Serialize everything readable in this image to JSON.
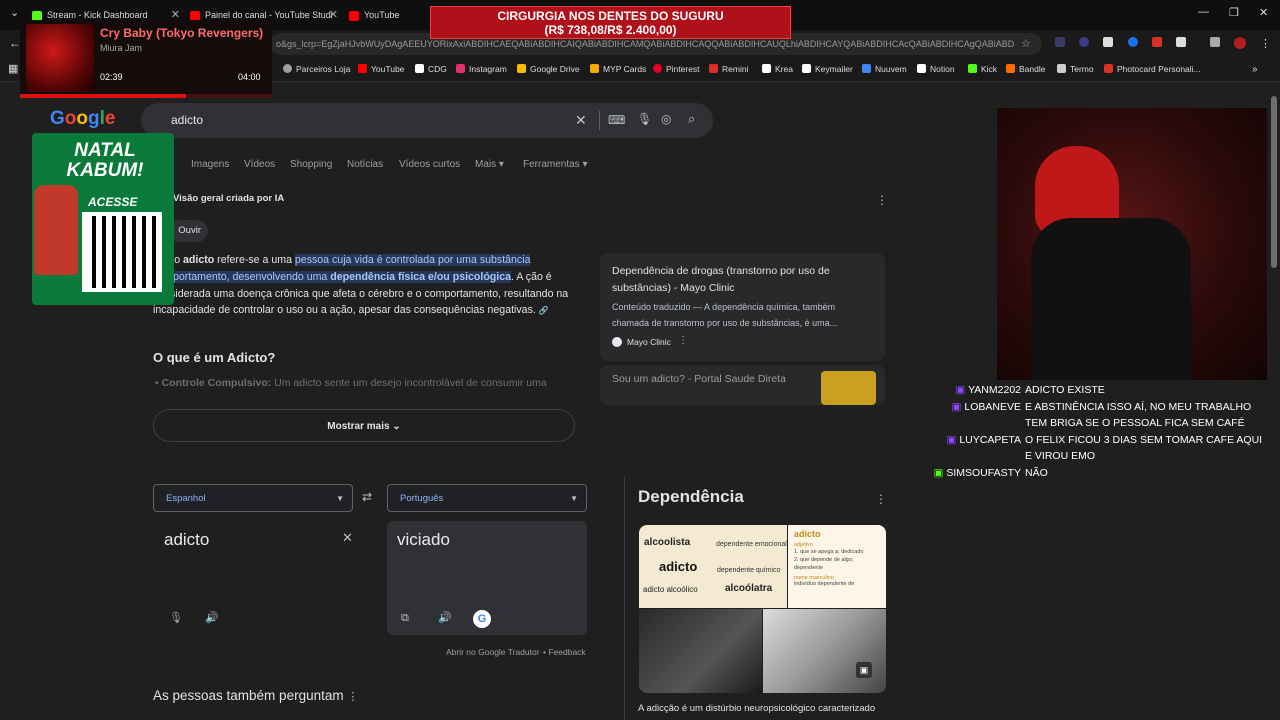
{
  "browser": {
    "tabs": [
      {
        "label": "Stream - Kick Dashboard",
        "color": "#53fc18"
      },
      {
        "label": "Painel do canal - YouTube Studi",
        "color": "#ff0000"
      },
      {
        "label": "YouTube",
        "color": "#ff0000"
      }
    ],
    "url": "o&gs_lcrp=EgZjaHJvbWUyDAgAEEUYORixAxiABDIHCAEQABiABDIHCAIQABiABDIHCAMQABiABDIHCAQQABiABDIHCAUQLhiABDIHCAYQABiABDIHCAcQABiABDIHCAgQABiABD",
    "bookmarks": [
      {
        "label": "Parceiros Loja",
        "color": "#9aa0a6"
      },
      {
        "label": "YouTube",
        "color": "#ff0000"
      },
      {
        "label": "CDG",
        "color": "#ffffff"
      },
      {
        "label": "Instagram",
        "color": "#e1306c"
      },
      {
        "label": "Google Drive",
        "color": "#fbbc04"
      },
      {
        "label": "MYP Cards",
        "color": "#f9ab00"
      },
      {
        "label": "Pinterest",
        "color": "#e60023"
      },
      {
        "label": "Remini",
        "color": "#d93025"
      },
      {
        "label": "Krea",
        "color": "#ffffff"
      },
      {
        "label": "Keymailer",
        "color": "#ffffff"
      },
      {
        "label": "Nuuvem",
        "color": "#4285f4"
      },
      {
        "label": "Notion",
        "color": "#ffffff"
      },
      {
        "label": "Kick",
        "color": "#53fc18"
      },
      {
        "label": "Bandle",
        "color": "#ff6d00"
      },
      {
        "label": "Termo",
        "color": "#cccccc"
      },
      {
        "label": "Photocard Personali...",
        "color": "#d93025"
      }
    ]
  },
  "overlay": {
    "song_title": "Cry Baby (Tokyo Revengers)",
    "song_artist": "Miura Jam",
    "time_current": "02:39",
    "time_total": "04:00",
    "progress": 0.66,
    "alert_line1": "CIRGURGIA NOS DENTES DO SUGURU",
    "alert_line2": "(R$ 738,08/R$ 2.400,00)",
    "promo_title": "NATAL KABUM!",
    "promo_cta": "ACESSE"
  },
  "google": {
    "logo": "Google",
    "query": "adicto",
    "nav_tabs": [
      "Imagens",
      "Vídeos",
      "Shopping",
      "Notícias",
      "Vídeos curtos",
      "Mais",
      "Ferramentas"
    ],
    "ai_label": "Visão geral criada por IA",
    "listen": "Ouvir",
    "ai_text": {
      "p1": "termo ",
      "p1b": "adicto",
      "p2": " refere-se a uma ",
      "hl1": "pessoa cuja vida é controlada por uma substância",
      "hl2": "comportamento, desenvolvendo uma ",
      "hl2b": "dependência física e/ou psicológica",
      "p3": ". A",
      "p4": "ção é considerada uma doença crônica que afeta o cérebro e o comportamento, resultando na incapacidade de controlar o uso ou a ação, apesar das consequências negativas."
    },
    "ai_heading": "O que é um Adicto?",
    "ai_bullet_b": "Controle Compulsivo:",
    "ai_bullet": " Um adicto sente um desejo incontrolável de consumir uma",
    "show_more": "Mostrar mais",
    "source1_title": "Dependência de drogas (transtorno por uso de substâncias) - Mayo Clinic",
    "source1_desc": "Conteúdo traduzido — A dependência química, também chamada de transtorno por uso de substâncias, é uma...",
    "source1_site": "Mayo Clinic",
    "source2_title": "Sou um adicto? - Portal Saude Direta",
    "translate": {
      "from": "Espanhol",
      "to": "Português",
      "source_word": "adicto",
      "target_word": "viciado",
      "open_link": "Abrir no Google Tradutor",
      "feedback": "Feedback"
    },
    "people_also_ask": "As pessoas também perguntam",
    "knowledge": {
      "title": "Dependência",
      "word_cloud": [
        "alcoolista",
        "dependente emocional",
        "adicto",
        "dependente químico",
        "adicto alcoólico",
        "alcoólatra"
      ],
      "dict_word": "adicto",
      "dict_pos": "adjetivo",
      "dict_def1": "1. que se apega a; dedicado",
      "dict_def2": "2. que depende de algo; dependente",
      "dict_noun": "nome masculino",
      "dict_noun_def": "indivíduo dependente de",
      "caption": "A adicção é um distúrbio neuropsicológico caracterizado"
    }
  },
  "chat": [
    {
      "user": "YANM2202",
      "color": "#ffffff",
      "msg": "ADICTO EXISTE"
    },
    {
      "user": "LOBANEVE",
      "color": "#ffffff",
      "msg": "E ABSTINÊNCIA ISSO AÍ, NO MEU TRABALHO TEM BRIGA SE O PESSOAL FICA SEM CAFÉ"
    },
    {
      "user": "LUYCAPETA",
      "color": "#ffffff",
      "msg": "O FELIX FICOU 3 DIAS SEM TOMAR CAFE AQUI E VIROU EMO"
    },
    {
      "user": "SIMSOUFASTY",
      "color": "#ffffff",
      "msg": "NÃO"
    }
  ],
  "colors": {
    "accent": "#8ab4f8",
    "highlight": "#27375a",
    "kick": "#53fc18",
    "alert": "#b0101a"
  }
}
